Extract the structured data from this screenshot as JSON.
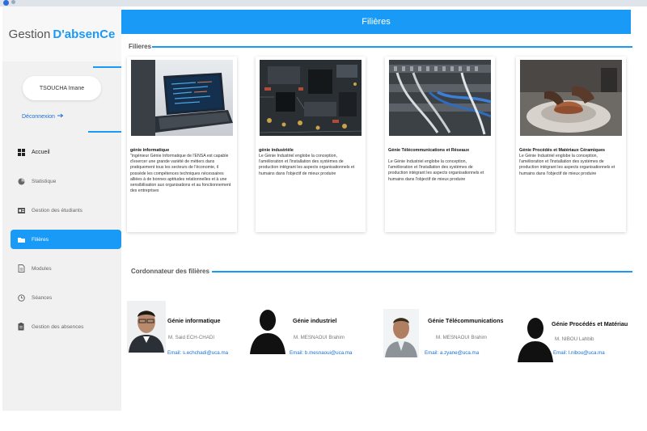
{
  "app": {
    "brand_prefix": "Gestion",
    "brand_accent": "D'absenCe",
    "accent_color": "#1a9af7"
  },
  "user": {
    "name": "TSOUCHA Imane",
    "logout_label": "Déconnexion",
    "logout_icon": "arrow-right-icon"
  },
  "sidebar": {
    "items": [
      {
        "label": "Accueil",
        "icon": "dashboard-icon",
        "active": false
      },
      {
        "label": "Statistique",
        "icon": "chart-icon",
        "active": false
      },
      {
        "label": "Gestion des étudiants",
        "icon": "students-icon",
        "active": false
      },
      {
        "label": "Filières",
        "icon": "folder-icon",
        "active": true
      },
      {
        "label": "Modules",
        "icon": "document-icon",
        "active": false
      },
      {
        "label": "Séances",
        "icon": "clock-icon",
        "active": false
      },
      {
        "label": "Gestion des absences",
        "icon": "clipboard-icon",
        "active": false
      }
    ]
  },
  "header": {
    "title": "Filières"
  },
  "filieres_section": {
    "title": "Filieres",
    "cards": [
      {
        "title": "génie informatique",
        "image": "laptop-image",
        "description": "\"ingénieur Génie Informatique de l'ENSA est capable d'exercer une grande variété de métiers dans pratiquement tous les secteurs de l'économie, il possède les compétences techniques nécessaires alliées à de bonnes aptitudes relationnelles et à une sensibilisation aux organisations et au fonctionnement des entreprises"
      },
      {
        "title": "génie industrièle",
        "image": "circuit-board-image",
        "description": "Le Génie Industriel englobe la conception, l'amélioration et l'installation des systèmes de production intégrant les aspects organisationnels et humains dans l'objectif de mieux produire"
      },
      {
        "title": "Génie Télécommunications et Réseaux",
        "image": "network-cables-image",
        "description": "Le Génie Industriel englobe la conception, l'amélioration et l'installation des systèmes de production intégrant les aspects organisationnels et humains dans l'objectif de mieux produire"
      },
      {
        "title": "Génie Procédés et Matériaux Céramiques",
        "image": "ceramics-pottery-image",
        "description": "Le Génie Industriel englobe la conception, l'amélioration et l'installation des systèmes de production intégrant les aspects organisationnels et humains dans l'objectif de mieux produire"
      }
    ]
  },
  "coordinators_section": {
    "title": "Cordonnateur des filières",
    "items": [
      {
        "filiere": "Génie informatique",
        "name": "M. Said ECH-CHADI",
        "email": "Email: s.echchadi@uca.ma",
        "photo": "person-photo"
      },
      {
        "filiere": "Génie industriel",
        "name": "M. MESNAOUI Brahim",
        "email": "Email: b.mesnaoui@uca.ma",
        "photo": "person-silhouette-icon"
      },
      {
        "filiere": "Génie Télécommunications",
        "name": "M. MESNAOUI Brahim",
        "email": "Email: a.zyane@uca.ma",
        "photo": "person-photo"
      },
      {
        "filiere": "Génie Procédés et Matériau",
        "name": "M. NIBOU Lahbib",
        "email": "Email: l.nibou@uca.ma",
        "photo": "person-silhouette-icon"
      }
    ]
  }
}
